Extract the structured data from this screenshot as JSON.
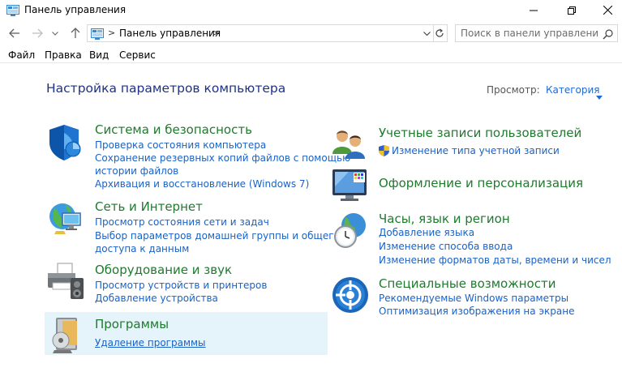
{
  "window": {
    "title": "Панель управления"
  },
  "address": {
    "crumb": "Панель управления",
    "separator": ">"
  },
  "search": {
    "placeholder": "Поиск в панели управления"
  },
  "menu": [
    "Файл",
    "Правка",
    "Вид",
    "Сервис"
  ],
  "main": {
    "heading": "Настройка параметров компьютера",
    "view_by_label": "Просмотр:",
    "view_by_value": "Категория"
  },
  "categories": {
    "security": {
      "title": "Система и безопасность",
      "links": [
        "Проверка состояния компьютера",
        "Сохранение резервных копий файлов с помощью",
        "истории файлов",
        "Архивация и восстановление (Windows 7)"
      ]
    },
    "network": {
      "title": "Сеть и Интернет",
      "links": [
        "Просмотр состояния сети и задач",
        "Выбор параметров домашней группы и общего",
        "доступа к данным"
      ]
    },
    "hardware": {
      "title": "Оборудование и звук",
      "links": [
        "Просмотр устройств и принтеров",
        "Добавление устройства"
      ]
    },
    "programs": {
      "title": "Программы",
      "links": [
        "Удаление программы"
      ]
    },
    "users": {
      "title": "Учетные записи пользователей",
      "links": [
        "Изменение типа учетной записи"
      ]
    },
    "appearance": {
      "title": "Оформление и персонализация",
      "links": []
    },
    "clock": {
      "title": "Часы, язык и регион",
      "links": [
        "Добавление языка",
        "Изменение способа ввода",
        "Изменение форматов даты, времени и чисел"
      ]
    },
    "access": {
      "title": "Специальные возможности",
      "links": [
        "Рекомендуемые Windows параметры",
        "Оптимизация изображения на экране"
      ]
    }
  },
  "colors": {
    "category_title": "#1f7a2e",
    "link": "#1a62c7",
    "heading": "#1e3287",
    "hover_bg": "#e5f3fb"
  }
}
